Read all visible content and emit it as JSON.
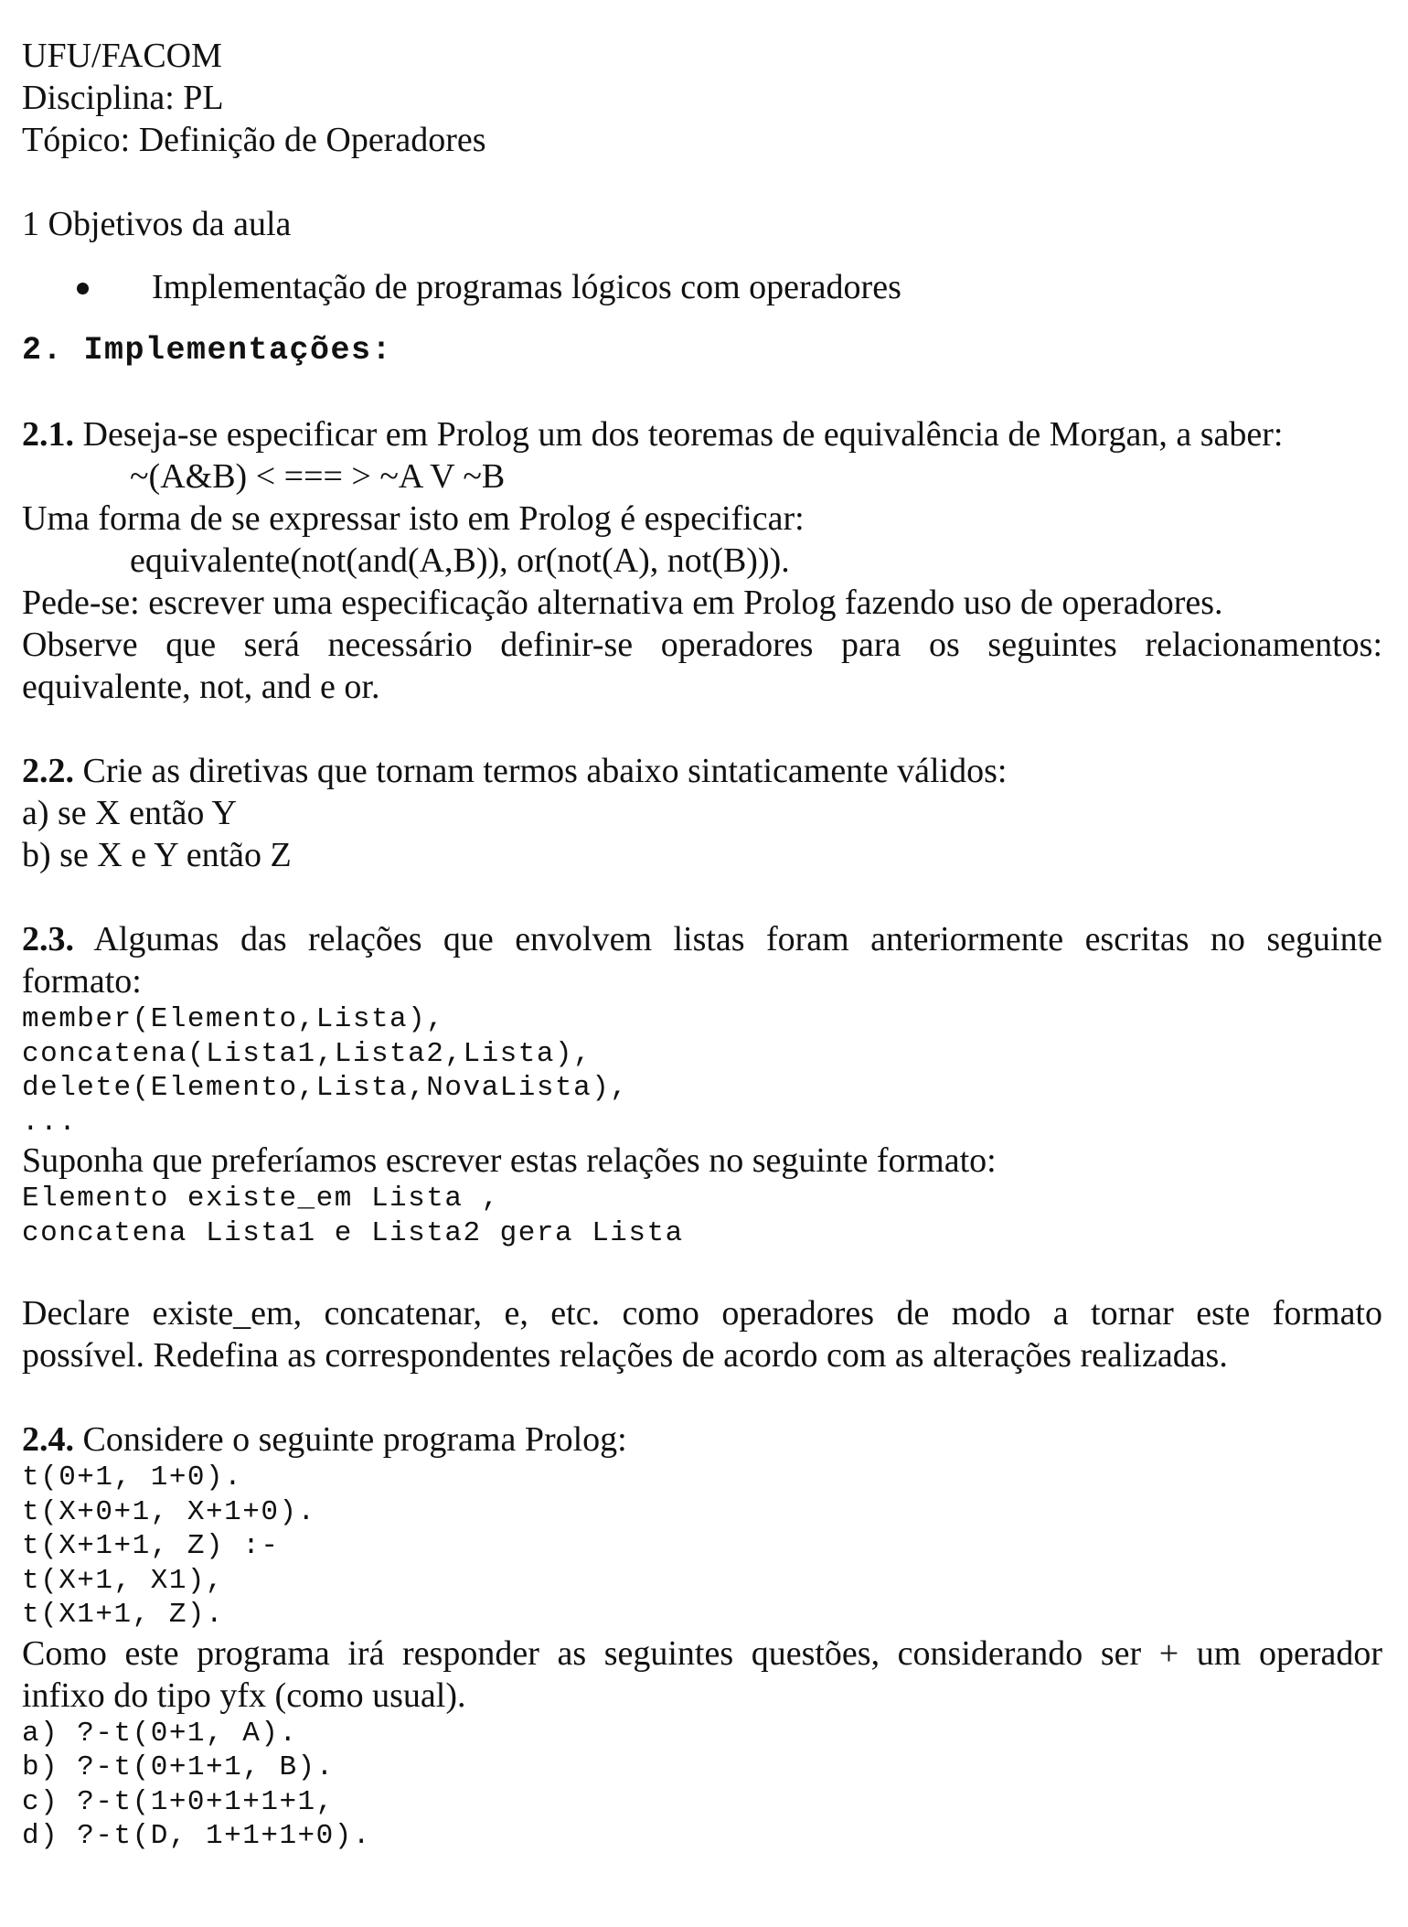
{
  "header": {
    "institution": "UFU/FACOM",
    "course": "Disciplina: PL",
    "topic": "Tópico: Definição de Operadores"
  },
  "section1": {
    "title": "1 Objetivos da aula",
    "bullets": [
      "Implementação de programas lógicos com operadores"
    ]
  },
  "section2": {
    "title": "2. Implementações:",
    "q1": {
      "num": "2.1.",
      "intro": " Deseja-se especificar em Prolog um dos teoremas de equivalência de Morgan, a saber:",
      "formula": "~(A&B) < === > ~A V ~B",
      "line2": "Uma forma de se expressar isto em Prolog é especificar:",
      "prolog": "equivalente(not(and(A,B)), or(not(A), not(B))).",
      "line3": "Pede-se: escrever uma especificação alternativa em Prolog fazendo uso de operadores.",
      "line4a": "Observe que será necessário definir-se operadores para os seguintes relacionamentos:",
      "line4b": "equivalente, not, and e or."
    },
    "q2": {
      "num": "2.2.",
      "intro": " Crie as diretivas que tornam termos abaixo sintaticamente válidos:",
      "a": "a) se X então Y",
      "b": "b) se X e Y então Z"
    },
    "q3": {
      "num": "2.3.",
      "intro_a": " Algumas das relações que envolvem listas foram anteriormente escritas no seguinte",
      "intro_b": "formato:",
      "code1": [
        "member(Elemento,Lista),",
        "concatena(Lista1,Lista2,Lista),",
        "delete(Elemento,Lista,NovaLista),",
        "..."
      ],
      "suppose": "Suponha que preferíamos escrever estas relações no seguinte formato:",
      "code2": [
        "Elemento existe_em Lista ,",
        "concatena Lista1 e Lista2 gera Lista"
      ],
      "declare_a": "Declare existe_em, concatenar, e, etc. como operadores de modo a tornar este formato",
      "declare_b": "possível. Redefina as correspondentes relações de acordo com as alterações realizadas."
    },
    "q4": {
      "num": "2.4.",
      "intro": " Considere o seguinte programa Prolog:",
      "code": [
        "t(0+1, 1+0).",
        "t(X+0+1, X+1+0).",
        "t(X+1+1, Z) :-",
        "t(X+1, X1),",
        "t(X1+1, Z)."
      ],
      "ask_a": "Como este programa irá responder as seguintes questões, considerando ser + um operador",
      "ask_b": "infixo do tipo yfx (como usual).",
      "queries": [
        "a) ?-t(0+1, A).",
        "b) ?-t(0+1+1, B).",
        "c) ?-t(1+0+1+1+1,",
        "d) ?-t(D, 1+1+1+0)."
      ]
    }
  }
}
